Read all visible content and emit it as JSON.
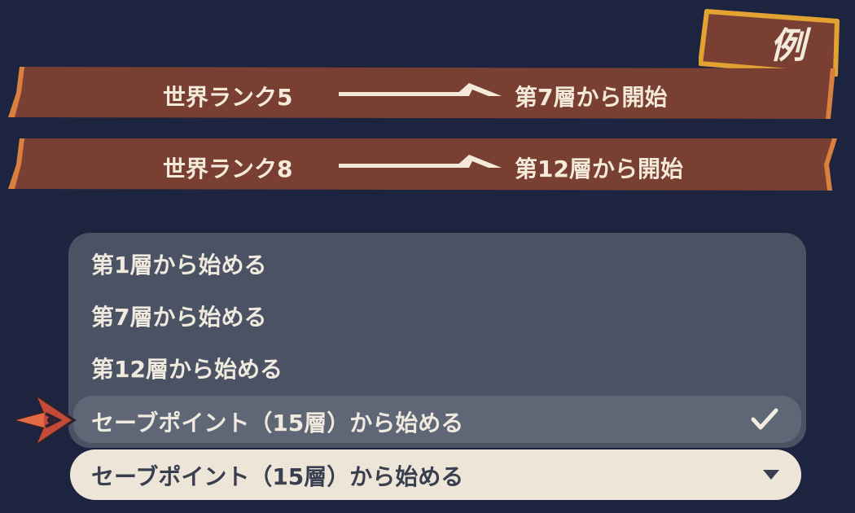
{
  "badge": {
    "label": "例"
  },
  "banners": [
    {
      "rank": "世界ランク5",
      "result": "第7層から開始"
    },
    {
      "rank": "世界ランク8",
      "result": "第12層から開始"
    }
  ],
  "dropdown": {
    "options": [
      {
        "label": "第1層から始める"
      },
      {
        "label": "第7層から始める"
      },
      {
        "label": "第12層から始める"
      },
      {
        "label": "セーブポイント（15層）から始める",
        "selected": true
      }
    ],
    "selected_value": "セーブポイント（15層）から始める"
  },
  "colors": {
    "background": "#1d2440",
    "banner": "#7a3f33",
    "banner_accent": "#d9803f",
    "badge_border": "#e3a332",
    "panel": "#4a5264",
    "selected_option": "#5f6777",
    "field": "#ece5d8"
  },
  "icons": [
    "arrow-right-icon",
    "check-icon",
    "chevron-down-icon",
    "cursor-arrow-icon"
  ]
}
